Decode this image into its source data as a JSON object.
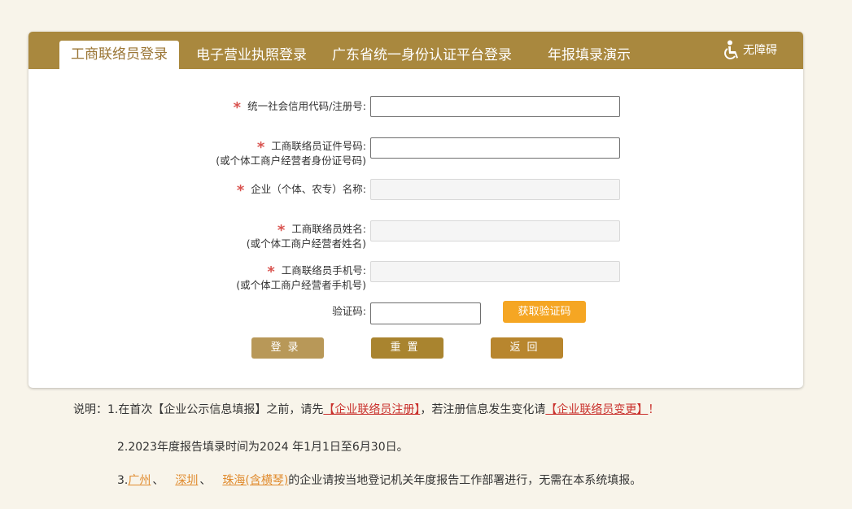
{
  "tabs": [
    {
      "label": "工商联络员登录",
      "active": true
    },
    {
      "label": "电子营业执照登录"
    },
    {
      "label": "广东省统一身份认证平台登录"
    },
    {
      "label": "年报填录演示"
    }
  ],
  "accessibility": {
    "label": "无障碍",
    "icon": "wheelchair-icon"
  },
  "form": {
    "credit_code": {
      "label": "统一社会信用代码/注册号:",
      "required": true,
      "value": ""
    },
    "id_number": {
      "label": "工商联络员证件号码:",
      "sub_label": "(或个体工商户经营者身份证号码)",
      "required": true,
      "value": ""
    },
    "company_name": {
      "label": "企业（个体、农专）名称:",
      "required": true,
      "value": ""
    },
    "contact_name": {
      "label": "工商联络员姓名:",
      "sub_label": "(或个体工商户经营者姓名)",
      "required": true,
      "value": ""
    },
    "mobile": {
      "label": "工商联络员手机号:",
      "sub_label": "(或个体工商户经营者手机号)",
      "required": true,
      "value": ""
    },
    "captcha": {
      "label": "验证码:",
      "value": ""
    },
    "get_code_label": "获取验证码",
    "required_mark": "*"
  },
  "buttons": {
    "login": "登录",
    "reset": "重置",
    "back": "返回"
  },
  "notes": {
    "prefix": "说明：",
    "line1": {
      "n": "1.在首次【企业公示信息填报】之前，请先",
      "link1": "【企业联络员注册】",
      "mid": "，若注册信息发生变化请",
      "link2": "【企业联络员变更】",
      "end": "！"
    },
    "line2": "2.2023年度报告填录时间为2024 年1月1日至6月30日。",
    "line3": {
      "n": "3.",
      "city1": "广州",
      "sep1": "、",
      "city2": "深圳",
      "sep2": "、",
      "city3": "珠海(含横琴)",
      "rest": "的企业请按当地登记机关年度报告工作部署进行，无需在本系统填报。"
    }
  },
  "colors": {
    "tabbar": "#a9883e",
    "login_btn": "#b89858",
    "reset_btn": "#a9842f",
    "back_btn": "#b8862e",
    "sms_btn": "#f5a623",
    "required": "#d9534f",
    "link_red": "#c9302c",
    "link_orange": "#e08a2c"
  }
}
